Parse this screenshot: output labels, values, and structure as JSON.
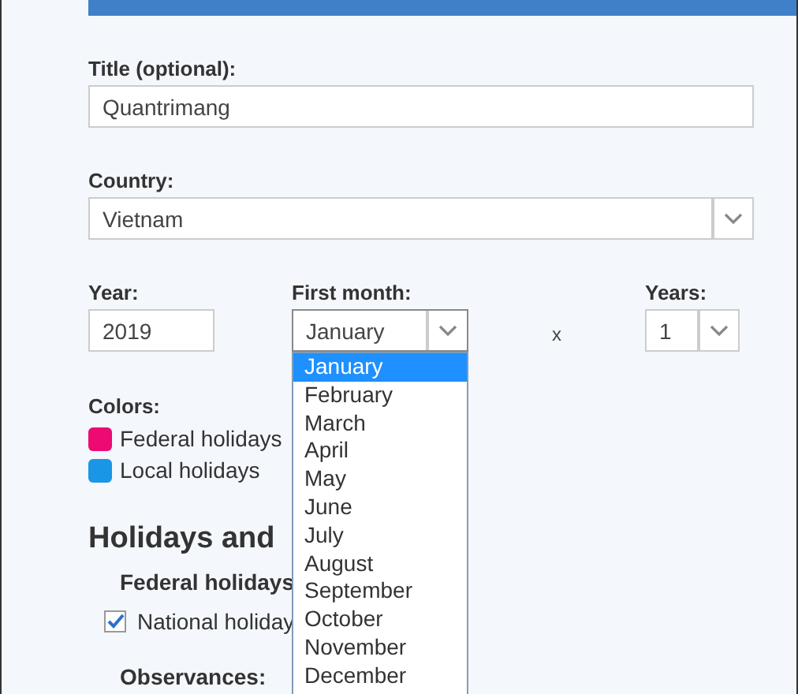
{
  "title_field": {
    "label": "Title (optional):",
    "value": "Quantrimang"
  },
  "country": {
    "label": "Country:",
    "value": "Vietnam"
  },
  "year": {
    "label": "Year:",
    "value": "2019"
  },
  "first_month": {
    "label": "First month:",
    "value": "January",
    "expanded": true,
    "options": [
      {
        "label": "January",
        "selected": true
      },
      {
        "label": "February",
        "selected": false
      },
      {
        "label": "March",
        "selected": false
      },
      {
        "label": "April",
        "selected": false
      },
      {
        "label": "May",
        "selected": false
      },
      {
        "label": "June",
        "selected": false
      },
      {
        "label": "July",
        "selected": false
      },
      {
        "label": "August",
        "selected": false
      },
      {
        "label": "September",
        "selected": false
      },
      {
        "label": "October",
        "selected": false
      },
      {
        "label": "November",
        "selected": false
      },
      {
        "label": "December",
        "selected": false
      }
    ]
  },
  "multiply": "x",
  "years": {
    "label": "Years:",
    "value": "1"
  },
  "colors": {
    "label": "Colors:",
    "items": [
      {
        "label": "Federal holidays",
        "color": "#ee0a73"
      },
      {
        "label": "Local holidays",
        "color": "#1a96e6"
      }
    ]
  },
  "section": {
    "heading": "Holidays and",
    "groups": [
      {
        "heading": "Federal holidays",
        "items": [
          {
            "label": "National holiday",
            "checked": true
          }
        ]
      }
    ],
    "next_heading": "Observances:"
  }
}
